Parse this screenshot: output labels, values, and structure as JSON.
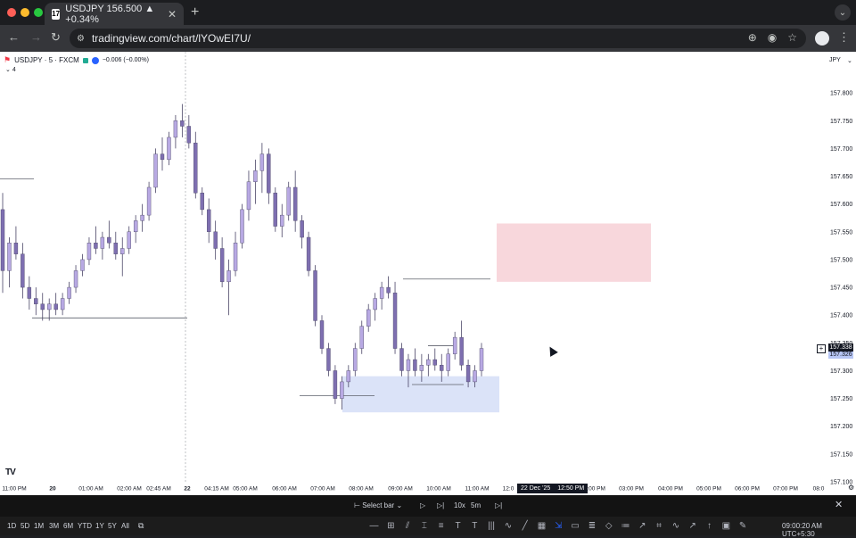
{
  "browser": {
    "tab_title": "USDJPY 156.500 ▲ +0.34%",
    "url": "tradingview.com/chart/lYOwEI7U/"
  },
  "chart": {
    "symbol_line": "USDJPY · 5 · FXCM",
    "change": "−0.006 (−0.00%)",
    "indicator_count": "4",
    "currency": "JPY",
    "crosshair_date": "22 Dec '25",
    "crosshair_time": "12:50 PM",
    "last_price": "157.338",
    "last_price_b": "157.326",
    "logo": "TV"
  },
  "chart_data": {
    "type": "candlestick",
    "symbol": "USDJPY",
    "interval": "5",
    "ylim": [
      157.1,
      157.85
    ],
    "y_ticks": [
      "157.800",
      "157.750",
      "157.700",
      "157.650",
      "157.600",
      "157.550",
      "157.500",
      "157.450",
      "157.400",
      "157.350",
      "157.300",
      "157.250",
      "157.200",
      "157.150",
      "157.100"
    ],
    "x_ticks": [
      "11:00 PM",
      "20",
      "01:00 AM",
      "02:00 AM",
      "02:45 AM",
      "22",
      "04:15 AM",
      "05:00 AM",
      "06:00 AM",
      "07:00 AM",
      "08:00 AM",
      "09:00 AM",
      "10:00 AM",
      "11:00 AM",
      "12:0",
      "01:00 PM",
      "02:00 PM",
      "03:00 PM",
      "04:00 PM",
      "05:00 PM",
      "06:00 PM",
      "07:00 PM",
      "08:0"
    ],
    "candles": [
      [
        157.59,
        157.62,
        157.44,
        157.48
      ],
      [
        157.48,
        157.54,
        157.45,
        157.53
      ],
      [
        157.53,
        157.56,
        157.5,
        157.51
      ],
      [
        157.51,
        157.53,
        157.43,
        157.45
      ],
      [
        157.45,
        157.47,
        157.41,
        157.43
      ],
      [
        157.43,
        157.45,
        157.4,
        157.42
      ],
      [
        157.42,
        157.44,
        157.39,
        157.41
      ],
      [
        157.41,
        157.43,
        157.39,
        157.42
      ],
      [
        157.42,
        157.44,
        157.4,
        157.41
      ],
      [
        157.41,
        157.44,
        157.4,
        157.43
      ],
      [
        157.43,
        157.46,
        157.42,
        157.45
      ],
      [
        157.45,
        157.49,
        157.44,
        157.48
      ],
      [
        157.48,
        157.51,
        157.47,
        157.5
      ],
      [
        157.5,
        157.54,
        157.49,
        157.53
      ],
      [
        157.53,
        157.56,
        157.51,
        157.52
      ],
      [
        157.52,
        157.55,
        157.5,
        157.54
      ],
      [
        157.54,
        157.57,
        157.52,
        157.53
      ],
      [
        157.53,
        157.55,
        157.5,
        157.51
      ],
      [
        157.51,
        157.54,
        157.47,
        157.52
      ],
      [
        157.52,
        157.56,
        157.51,
        157.55
      ],
      [
        157.55,
        157.58,
        157.53,
        157.57
      ],
      [
        157.57,
        157.6,
        157.55,
        157.58
      ],
      [
        157.58,
        157.64,
        157.57,
        157.63
      ],
      [
        157.63,
        157.7,
        157.62,
        157.69
      ],
      [
        157.69,
        157.72,
        157.66,
        157.68
      ],
      [
        157.68,
        157.73,
        157.67,
        157.72
      ],
      [
        157.72,
        157.76,
        157.7,
        157.75
      ],
      [
        157.75,
        157.78,
        157.72,
        157.74
      ],
      [
        157.74,
        157.76,
        157.7,
        157.71
      ],
      [
        157.71,
        157.73,
        157.61,
        157.62
      ],
      [
        157.62,
        157.63,
        157.58,
        157.59
      ],
      [
        157.59,
        157.61,
        157.53,
        157.55
      ],
      [
        157.55,
        157.57,
        157.5,
        157.52
      ],
      [
        157.52,
        157.54,
        157.45,
        157.46
      ],
      [
        157.46,
        157.5,
        157.4,
        157.48
      ],
      [
        157.48,
        157.55,
        157.47,
        157.53
      ],
      [
        157.53,
        157.6,
        157.52,
        157.59
      ],
      [
        157.59,
        157.66,
        157.57,
        157.64
      ],
      [
        157.64,
        157.68,
        157.6,
        157.66
      ],
      [
        157.66,
        157.71,
        157.62,
        157.69
      ],
      [
        157.69,
        157.7,
        157.6,
        157.62
      ],
      [
        157.62,
        157.63,
        157.55,
        157.56
      ],
      [
        157.56,
        157.6,
        157.54,
        157.58
      ],
      [
        157.58,
        157.64,
        157.57,
        157.63
      ],
      [
        157.63,
        157.66,
        157.55,
        157.57
      ],
      [
        157.57,
        157.58,
        157.52,
        157.54
      ],
      [
        157.54,
        157.55,
        157.47,
        157.48
      ],
      [
        157.48,
        157.49,
        157.38,
        157.39
      ],
      [
        157.39,
        157.4,
        157.33,
        157.34
      ],
      [
        157.34,
        157.35,
        157.29,
        157.3
      ],
      [
        157.3,
        157.31,
        157.24,
        157.25
      ],
      [
        157.25,
        157.29,
        157.23,
        157.28
      ],
      [
        157.28,
        157.31,
        157.27,
        157.3
      ],
      [
        157.3,
        157.35,
        157.29,
        157.34
      ],
      [
        157.34,
        157.39,
        157.33,
        157.38
      ],
      [
        157.38,
        157.42,
        157.37,
        157.41
      ],
      [
        157.41,
        157.44,
        157.39,
        157.43
      ],
      [
        157.43,
        157.46,
        157.41,
        157.45
      ],
      [
        157.45,
        157.47,
        157.43,
        157.44
      ],
      [
        157.44,
        157.46,
        157.33,
        157.34
      ],
      [
        157.34,
        157.35,
        157.29,
        157.3
      ],
      [
        157.3,
        157.33,
        157.27,
        157.32
      ],
      [
        157.32,
        157.34,
        157.29,
        157.3
      ],
      [
        157.3,
        157.33,
        157.28,
        157.31
      ],
      [
        157.31,
        157.33,
        157.29,
        157.32
      ],
      [
        157.32,
        157.34,
        157.3,
        157.31
      ],
      [
        157.31,
        157.33,
        157.28,
        157.3
      ],
      [
        157.3,
        157.34,
        157.29,
        157.33
      ],
      [
        157.33,
        157.37,
        157.32,
        157.36
      ],
      [
        157.36,
        157.39,
        157.3,
        157.31
      ],
      [
        157.31,
        157.32,
        157.27,
        157.28
      ],
      [
        157.28,
        157.31,
        157.27,
        157.3
      ],
      [
        157.3,
        157.35,
        157.29,
        157.34
      ]
    ],
    "zones": [
      {
        "kind": "supply",
        "color": "#f8d7dc",
        "top": 157.565,
        "bottom": 157.46
      },
      {
        "kind": "demand",
        "color": "#dbe3f8",
        "top": 157.29,
        "bottom": 157.225
      }
    ],
    "hlines": [
      157.645,
      157.395,
      157.465,
      157.255,
      157.345,
      157.275
    ]
  },
  "bottom_toolbar": {
    "select_bar": "Select bar",
    "speed": "10x",
    "interval": "5m"
  },
  "footer": {
    "timeframes": [
      "1D",
      "5D",
      "1M",
      "3M",
      "6M",
      "YTD",
      "1Y",
      "5Y",
      "All"
    ],
    "clock": "09:00:20 AM UTC+5:30"
  },
  "colors": {
    "candle": "#7e6fb0",
    "candle_up": "#b8a9e3",
    "wick": "#4a4566"
  }
}
